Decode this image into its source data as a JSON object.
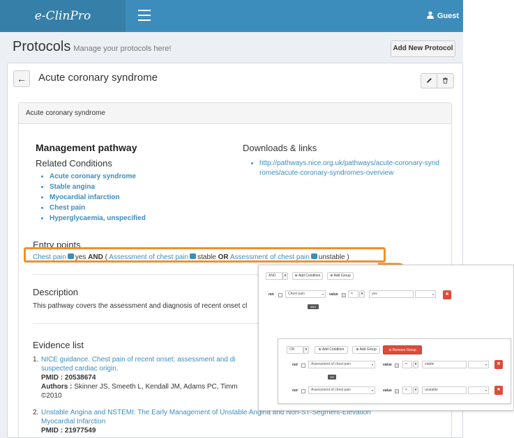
{
  "app": {
    "brand": "e-ClinPro",
    "user": "Guest"
  },
  "header": {
    "title": "Protocols",
    "subtitle": "Manage your protocols here!",
    "add_button": "Add New Protocol"
  },
  "protocol": {
    "title": "Acute coronary syndrome",
    "card_header": "Acute coronary syndrome",
    "management_heading": "Management pathway",
    "related_heading": "Related Conditions",
    "related_conditions": [
      "Acute coronary syndrome",
      "Stable angina",
      "Myocardial infarction",
      "Chest pain",
      "Hyperglycaemia, unspecified"
    ],
    "downloads_heading": "Downloads & links",
    "links": [
      "http://pathways.nice.org.uk/pathways/acute-coronary-syndromes/acute-coronary-syndromes-overview"
    ],
    "entry_heading": "Entry points",
    "entry": {
      "t1": "Chest pain",
      "v1": "yes",
      "op": "AND",
      "open": "(",
      "t2": "Assessment of chest pain",
      "v2": "stable",
      "or": "OR",
      "t3": "Assessment of chest pain",
      "v3": "unstable",
      "close": ")"
    },
    "description_heading": "Description",
    "description": "This pathway covers the assessment and diagnosis of recent onset cl",
    "evidence_heading": "Evidence list",
    "evidence": [
      {
        "num": "1.",
        "title_line1": "NICE guidance. Chest pain of recent onset: assessment and di",
        "title_line2": "suspected cardiac origin.",
        "pmid_label": "PMID :",
        "pmid": "20538674",
        "authors_label": "Authors :",
        "authors": "Skinner JS, Smeeth L, Kendall JM, Adams PC, Timm",
        "year": "©2010"
      },
      {
        "num": "2.",
        "title_line1": "Unstable Angina and NSTEMI: The Early Management of Unstable Angina and Non-ST-Segment-Elevation",
        "title_line2": "Myocardial Infarction",
        "pmid_label": "PMID :",
        "pmid": "21977549"
      }
    ]
  },
  "query_builder": {
    "outer": {
      "condition": "AND",
      "add_condition": "Add Condition",
      "add_group": "Add Group",
      "rule": {
        "not": "not",
        "field": "Chest pain",
        "value_label": "value",
        "operator": "=",
        "value": "yes"
      },
      "join_chip": "AND"
    },
    "inner": {
      "condition": "OR",
      "add_condition": "Add Condition",
      "add_group": "Add Group",
      "remove_group": "Remove Group",
      "rules": [
        {
          "not": "not",
          "field": "Assessment of chest pain",
          "value_label": "value",
          "operator": "=",
          "value": "stable"
        },
        {
          "not": "not",
          "field": "Assessment of chest pain",
          "value_label": "value",
          "operator": "=",
          "value": "unstable"
        }
      ],
      "join_chip": "OR"
    }
  },
  "colors": {
    "topbar": "#3c8dbc",
    "logo_bg": "#367fa9",
    "link": "#3c8dbc",
    "highlight": "#f0902b",
    "danger": "#dd4b39"
  }
}
